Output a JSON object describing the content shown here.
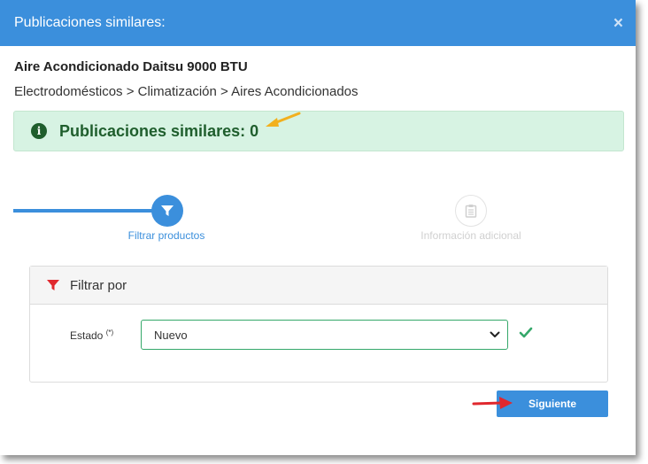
{
  "modal": {
    "title": "Publicaciones similares:",
    "close_symbol": "×"
  },
  "product": {
    "title": "Aire Acondicionado Daitsu 9000 BTU",
    "breadcrumb": "Electrodomésticos > Climatización > Aires Acondicionados"
  },
  "alert": {
    "text": "Publicaciones similares: 0",
    "icon_glyph": "i",
    "icon": "info-circle-icon"
  },
  "steps": [
    {
      "label": "Filtrar productos",
      "icon": "filter-icon",
      "active": true
    },
    {
      "label": "Información adicional",
      "icon": "clipboard-icon",
      "active": false
    }
  ],
  "filter_panel": {
    "title": "Filtrar por",
    "field": {
      "label": "Estado",
      "required_mark": "(*)",
      "value": "Nuevo"
    }
  },
  "next_button": {
    "label": "Siguiente"
  },
  "colors": {
    "primary": "#3b8fdc",
    "alert_bg": "#d7f3e3",
    "alert_text": "#1f5e2d",
    "filter_red": "#e0282e",
    "valid_green": "#35a86a",
    "annotation_yellow": "#f2b01e",
    "annotation_red": "#e0282e"
  }
}
